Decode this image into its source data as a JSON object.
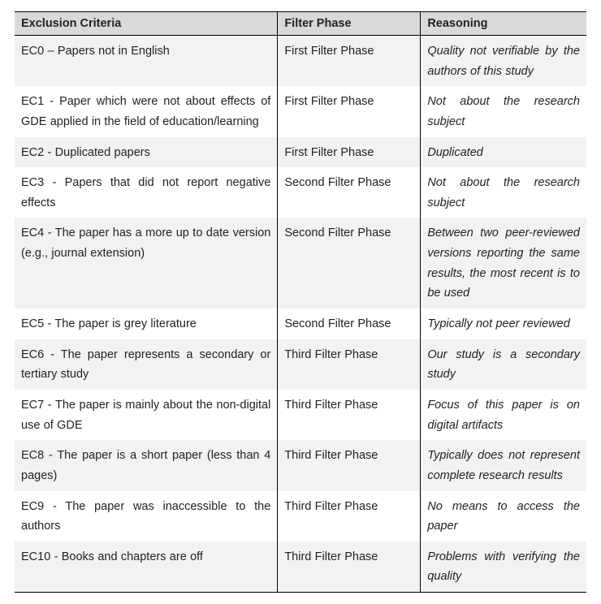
{
  "table": {
    "headers": {
      "c1": "Exclusion Criteria",
      "c2": "Filter Phase",
      "c3": "Reasoning"
    },
    "rows": [
      {
        "criteria": "EC0 – Papers not in English",
        "phase": "First Filter Phase",
        "reason": "Quality not verifiable by the authors of this study"
      },
      {
        "criteria": "EC1 - Paper which were not about effects of GDE applied in the field of education/learning",
        "phase": "First Filter Phase",
        "reason": "Not about the research subject"
      },
      {
        "criteria": "EC2 - Duplicated papers",
        "phase": "First Filter Phase",
        "reason": "Duplicated"
      },
      {
        "criteria": "EC3 - Papers that did not report negative effects",
        "phase": "Second Filter Phase",
        "reason": "Not about the research subject"
      },
      {
        "criteria": "EC4 - The paper has a more up to date version (e.g., journal extension)",
        "phase": "Second Filter Phase",
        "reason": "Between two peer-reviewed versions reporting the same results, the most recent is to be used"
      },
      {
        "criteria": "EC5 - The paper is grey literature",
        "phase": "Second Filter Phase",
        "reason": "Typically not peer reviewed"
      },
      {
        "criteria": "EC6 - The paper represents a secondary or tertiary study",
        "phase": "Third Filter Phase",
        "reason": "Our study is a secondary study"
      },
      {
        "criteria": "EC7 - The paper is mainly about the non-digital use of GDE",
        "phase": "Third Filter Phase",
        "reason": "Focus of this paper is on digital artifacts"
      },
      {
        "criteria": "EC8 - The paper is a short paper (less than 4 pages)",
        "phase": "Third Filter Phase",
        "reason": "Typically does not represent complete research results"
      },
      {
        "criteria": "EC9 - The paper was inaccessible to the authors",
        "phase": "Third Filter Phase",
        "reason": "No means to access the paper"
      },
      {
        "criteria": "EC10 - Books and chapters are off",
        "phase": "Third Filter Phase",
        "reason": "Problems with verifying the quality"
      }
    ]
  }
}
